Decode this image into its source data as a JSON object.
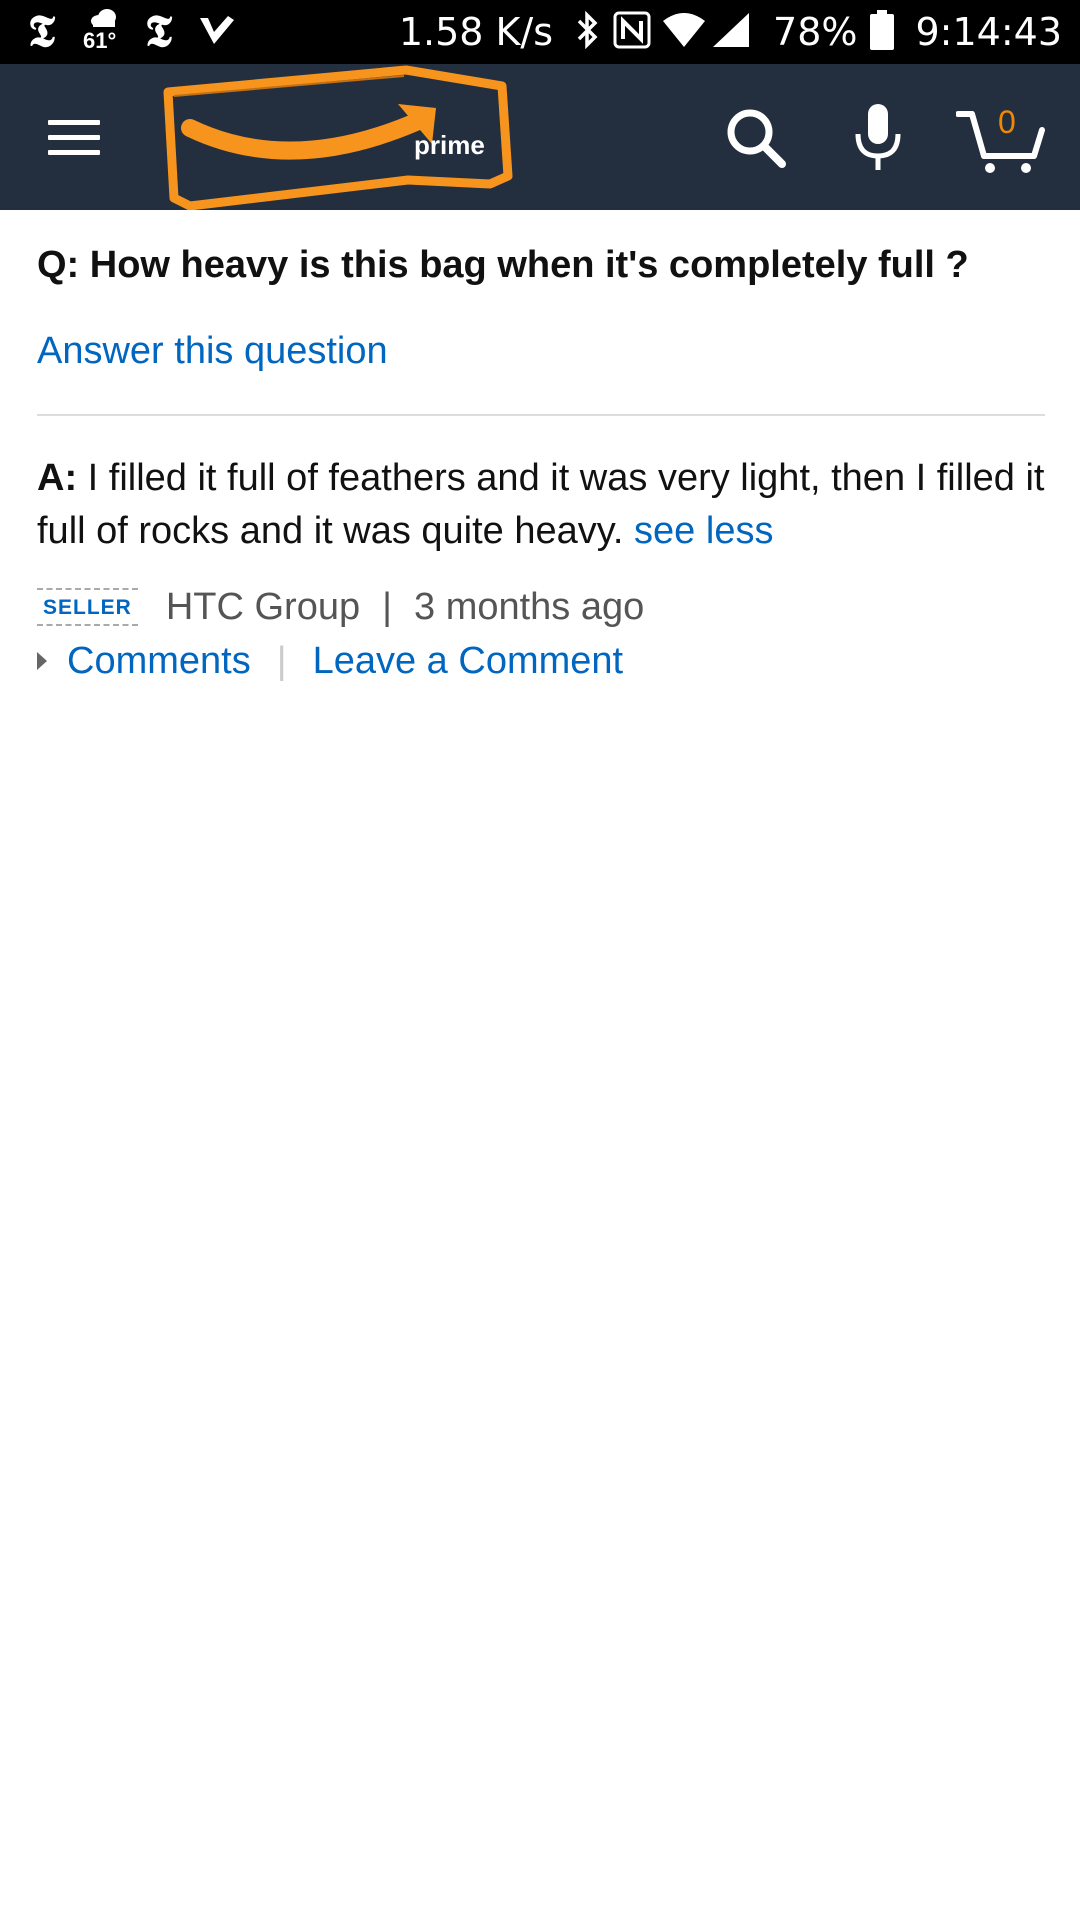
{
  "status_bar": {
    "temperature": "61°",
    "network_speed": "1.58 K/s",
    "battery": "78%",
    "time": "9:14:43",
    "icons": [
      "nyt-icon",
      "weather-icon",
      "nyt-icon",
      "check-icon",
      "bluetooth-icon",
      "nfc-icon",
      "wifi-icon",
      "signal-icon",
      "battery-icon"
    ]
  },
  "header": {
    "logo_text": "prime",
    "cart_count": "0",
    "colors": {
      "background": "#232f3e",
      "logo_accent": "#f7941d",
      "cart_count": "#f08804"
    }
  },
  "qa": {
    "question": "Q: How heavy is this bag when it's completely full ?",
    "answer_link": "Answer this question",
    "answer_label": "A:",
    "answer_text": " I filled it full of feathers and it was very light, then I filled it full of rocks and it was quite heavy. ",
    "see_less": "see less",
    "badge": "SELLER",
    "author": "HTC Group",
    "separator": "|",
    "time_ago": "3 months ago",
    "comments_link": "Comments",
    "comments_separator": "|",
    "leave_comment_link": "Leave a Comment",
    "colors": {
      "link": "#0066c0",
      "text": "#111111",
      "meta": "#555555"
    }
  }
}
